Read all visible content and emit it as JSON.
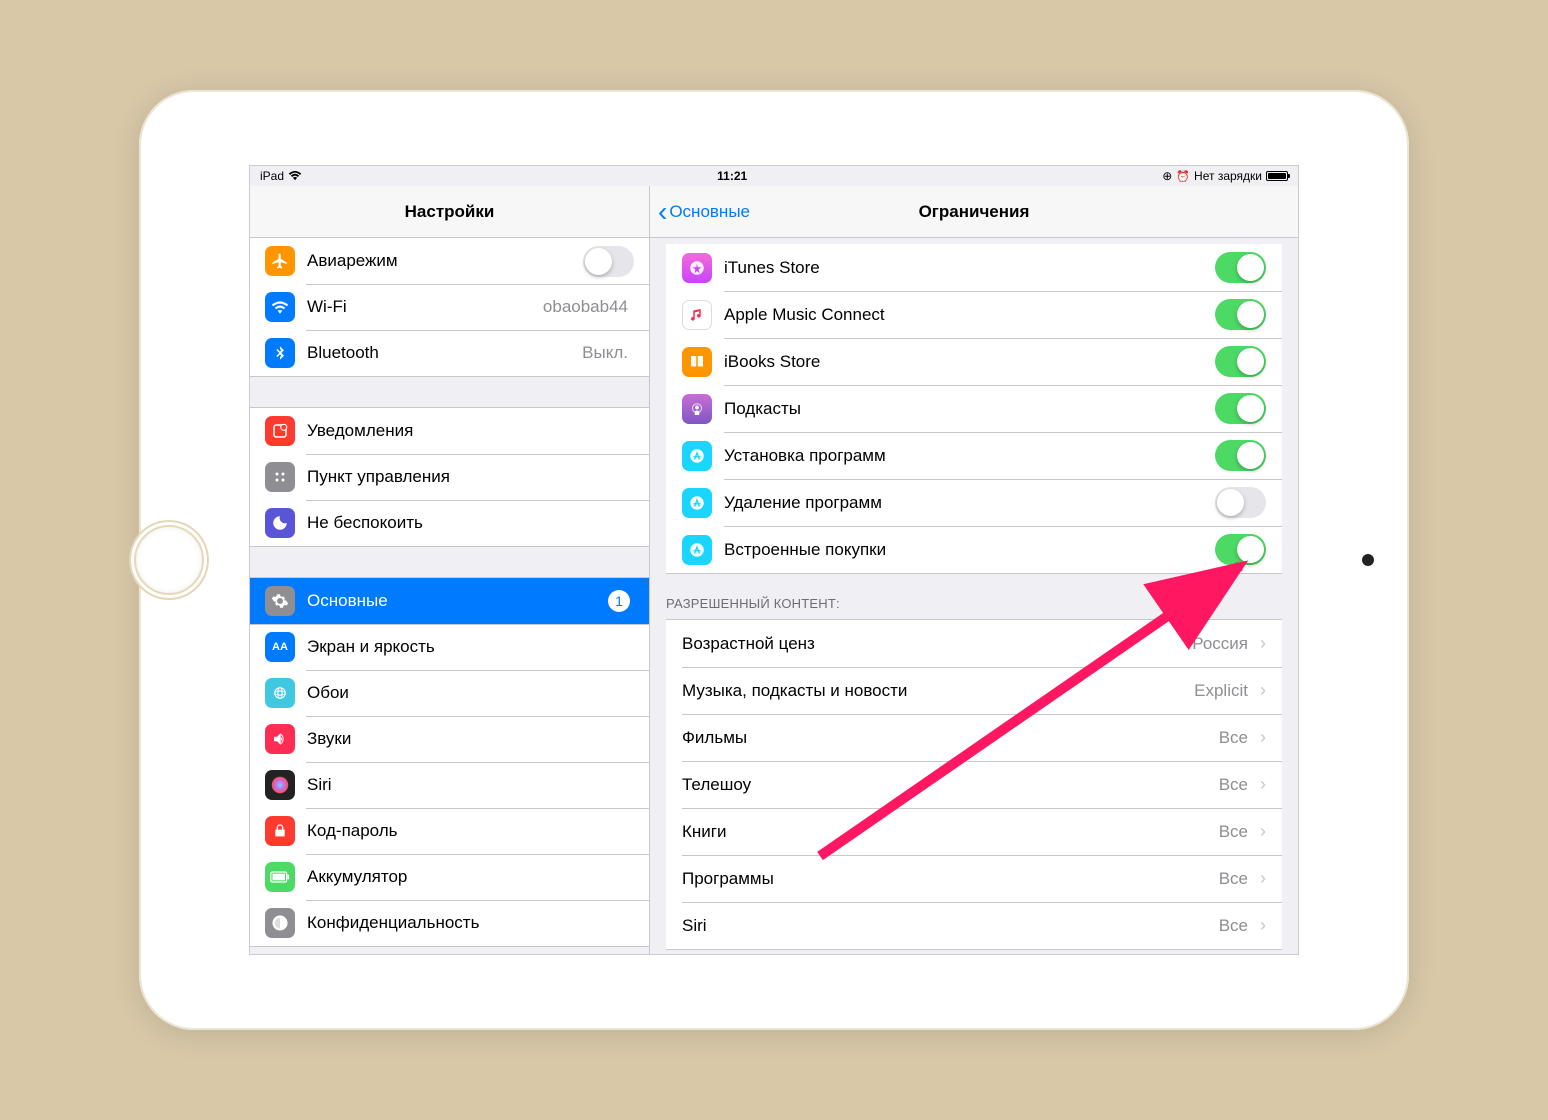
{
  "status": {
    "device": "iPad",
    "time": "11:21",
    "charging_text": "Нет зарядки"
  },
  "sidebar": {
    "title": "Настройки",
    "items": [
      {
        "label": "Авиарежим",
        "icon_bg": "#ff9500",
        "icon": "airplane",
        "switch": false
      },
      {
        "label": "Wi-Fi",
        "icon_bg": "#007aff",
        "icon": "wifi",
        "value": "obaobab44"
      },
      {
        "label": "Bluetooth",
        "icon_bg": "#007aff",
        "icon": "bluetooth",
        "value": "Выкл."
      },
      {
        "label": "Уведомления",
        "icon_bg": "#ff3b30",
        "icon": "notifications"
      },
      {
        "label": "Пункт управления",
        "icon_bg": "#8e8e93",
        "icon": "control-center"
      },
      {
        "label": "Не беспокоить",
        "icon_bg": "#5856d6",
        "icon": "dnd"
      },
      {
        "label": "Основные",
        "icon_bg": "#8e8e93",
        "icon": "gear",
        "selected": true,
        "badge": "1"
      },
      {
        "label": "Экран и яркость",
        "icon_bg": "#007aff",
        "icon": "display"
      },
      {
        "label": "Обои",
        "icon_bg": "#40c8e0",
        "icon": "wallpaper"
      },
      {
        "label": "Звуки",
        "icon_bg": "#ff2d55",
        "icon": "sounds"
      },
      {
        "label": "Siri",
        "icon_bg": "#222",
        "icon": "siri"
      },
      {
        "label": "Код-пароль",
        "icon_bg": "#ff3b30",
        "icon": "passcode"
      },
      {
        "label": "Аккумулятор",
        "icon_bg": "#4cd964",
        "icon": "battery"
      },
      {
        "label": "Конфиденциальность",
        "icon_bg": "#8e8e93",
        "icon": "privacy"
      }
    ]
  },
  "detail": {
    "back_label": "Основные",
    "title": "Ограничения",
    "toggles": [
      {
        "label": "iTunes Store",
        "icon_bg": "linear-gradient(180deg,#f66bd8,#c644fc)",
        "on": true
      },
      {
        "label": "Apple Music Connect",
        "icon_bg": "#fff",
        "border": true,
        "on": true
      },
      {
        "label": "iBooks Store",
        "icon_bg": "#ff9500",
        "on": true
      },
      {
        "label": "Подкасты",
        "icon_bg": "linear-gradient(180deg,#c86dd7,#7e57c2)",
        "on": true
      },
      {
        "label": "Установка программ",
        "icon_bg": "#1ad6fd",
        "on": true
      },
      {
        "label": "Удаление программ",
        "icon_bg": "#1ad6fd",
        "on": false
      },
      {
        "label": "Встроенные покупки",
        "icon_bg": "#1ad6fd",
        "on": true
      }
    ],
    "content_header": "РАЗРЕШЕННЫЙ КОНТЕНТ:",
    "content_rows": [
      {
        "label": "Возрастной ценз",
        "value": "Россия"
      },
      {
        "label": "Музыка, подкасты и новости",
        "value": "Explicit"
      },
      {
        "label": "Фильмы",
        "value": "Все"
      },
      {
        "label": "Телешоу",
        "value": "Все"
      },
      {
        "label": "Книги",
        "value": "Все"
      },
      {
        "label": "Программы",
        "value": "Все"
      },
      {
        "label": "Siri",
        "value": "Все"
      }
    ]
  }
}
